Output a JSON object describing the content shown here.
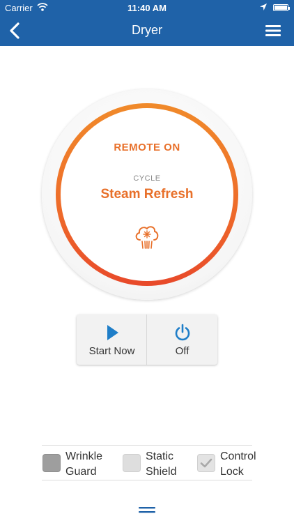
{
  "status_bar": {
    "carrier": "Carrier",
    "time": "11:40 AM",
    "icons": [
      "wifi-icon",
      "location-arrow-icon",
      "battery-icon"
    ]
  },
  "nav": {
    "title": "Dryer",
    "back_icon": "chevron-left-icon",
    "menu_icon": "hamburger-menu-icon"
  },
  "dial": {
    "status": "REMOTE ON",
    "cycle_label": "CYCLE",
    "cycle_name": "Steam Refresh",
    "cycle_icon": "steam-refresh-icon"
  },
  "actions": {
    "start_label": "Start Now",
    "start_icon": "play-icon",
    "off_label": "Off",
    "off_icon": "power-icon"
  },
  "options": [
    {
      "label_line1": "Wrinkle",
      "label_line2": "Guard",
      "state": "dark"
    },
    {
      "label_line1": "Static",
      "label_line2": "Shield",
      "state": "light"
    },
    {
      "label_line1": "Control",
      "label_line2": "Lock",
      "state": "checked"
    }
  ],
  "colors": {
    "brand_blue": "#1f62a8",
    "accent_orange": "#e8702a",
    "ring_red": "#e8492a",
    "action_blue": "#1f7ec8"
  }
}
